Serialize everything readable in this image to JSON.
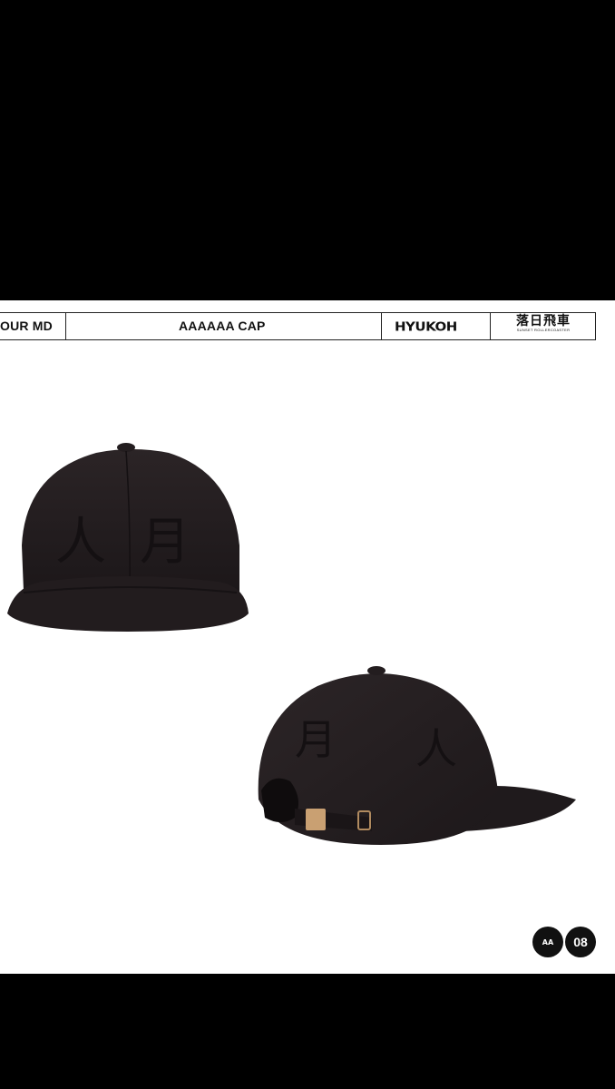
{
  "header": {
    "left_label": "OUR MD",
    "title": "AAAAAA CAP",
    "brand_logo": "HYUKOH",
    "collab_logo_cjk": "落日飛車",
    "collab_logo_sub": "SUNSET ROLLERCOASTER"
  },
  "images": {
    "front": {
      "name": "cap-front-photo",
      "embroidery": [
        "人",
        "月"
      ]
    },
    "back": {
      "name": "cap-back-photo",
      "embroidery": [
        "月",
        "人"
      ]
    }
  },
  "badge": {
    "logo_text": "AA",
    "number": "08"
  },
  "colors": {
    "background": "#000000",
    "page": "#ffffff",
    "cap": "#231d1f"
  }
}
